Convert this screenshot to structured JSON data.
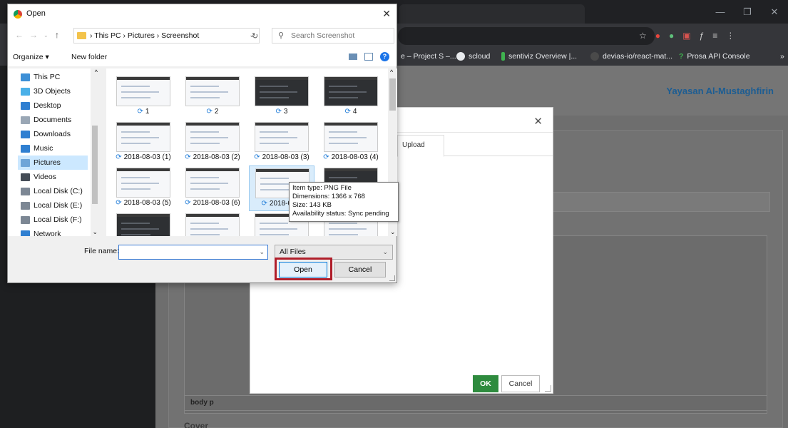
{
  "browser": {
    "window_controls": [
      "—",
      "❐",
      "✕"
    ],
    "bookmarks": [
      {
        "label": "e – Project S –...",
        "icon": "page-icon",
        "color": "#7aa3d8"
      },
      {
        "label": "scloud",
        "icon": "scloud-icon",
        "color": "#e8eaed"
      },
      {
        "label": "sentiviz Overview |...",
        "icon": "leaf-icon",
        "color": "#3fb24f"
      },
      {
        "label": "devias-io/react-mat...",
        "icon": "github-icon",
        "color": "#4a4a4a"
      },
      {
        "label": "Prosa API Console",
        "icon": "prosa-icon",
        "color": "#3fb24f"
      }
    ],
    "bookmarks_more": "»"
  },
  "page": {
    "site_name": "Yayasan Al-Mustaghfirin",
    "editor_path": "body  p",
    "cover_label": "Cover"
  },
  "web_modal": {
    "close": "✕",
    "tab_label": "Upload",
    "ok_label": "OK",
    "cancel_label": "Cancel"
  },
  "file_dialog": {
    "title": "Open",
    "close": "✕",
    "breadcrumb": "›  This PC  ›  Pictures  ›  Screenshot",
    "search_placeholder": "Search Screenshot",
    "organize_label": "Organize ▾",
    "new_folder_label": "New folder",
    "tree": [
      {
        "label": "This PC",
        "icon": "computer-icon",
        "color": "#3d8fd6"
      },
      {
        "label": "3D Objects",
        "icon": "cube-icon",
        "color": "#4ab0e8"
      },
      {
        "label": "Desktop",
        "icon": "desktop-icon",
        "color": "#2f7fd1"
      },
      {
        "label": "Documents",
        "icon": "document-icon",
        "color": "#9aa7b5"
      },
      {
        "label": "Downloads",
        "icon": "download-icon",
        "color": "#2f7fd1"
      },
      {
        "label": "Music",
        "icon": "music-icon",
        "color": "#2f7fd1"
      },
      {
        "label": "Pictures",
        "icon": "pictures-icon",
        "color": "#6fa5d8",
        "selected": true
      },
      {
        "label": "Videos",
        "icon": "videos-icon",
        "color": "#444c56"
      },
      {
        "label": "Local Disk (C:)",
        "icon": "disk-icon",
        "color": "#7c8794"
      },
      {
        "label": "Local Disk (E:)",
        "icon": "disk-icon",
        "color": "#7c8794"
      },
      {
        "label": "Local Disk (F:)",
        "icon": "disk-icon",
        "color": "#7c8794"
      },
      {
        "label": "Network",
        "icon": "network-icon",
        "color": "#2f7fd1"
      }
    ],
    "files": [
      {
        "name": "1",
        "dark": false
      },
      {
        "name": "2",
        "dark": false
      },
      {
        "name": "3",
        "dark": true
      },
      {
        "name": "4",
        "dark": true
      },
      {
        "name": "2018-08-03 (1)",
        "dark": false
      },
      {
        "name": "2018-08-03 (2)",
        "dark": false
      },
      {
        "name": "2018-08-03 (3)",
        "dark": false
      },
      {
        "name": "2018-08-03 (4)",
        "dark": false
      },
      {
        "name": "2018-08-03 (5)",
        "dark": false
      },
      {
        "name": "2018-08-03 (6)",
        "dark": false
      },
      {
        "name": "2018-08-0",
        "dark": false,
        "selected": true
      },
      {
        "name": "",
        "dark": true
      },
      {
        "name": "",
        "dark": true
      },
      {
        "name": "",
        "dark": false
      },
      {
        "name": "",
        "dark": false
      },
      {
        "name": "",
        "dark": false
      }
    ],
    "tooltip": {
      "type": "Item type: PNG File",
      "dimensions": "Dimensions: 1366 x 768",
      "size": "Size: 143 KB",
      "status": "Availability status: Sync pending"
    },
    "file_name_label": "File name:",
    "file_name_value": "",
    "filter_value": "All Files",
    "open_label": "Open",
    "cancel_label": "Cancel"
  }
}
